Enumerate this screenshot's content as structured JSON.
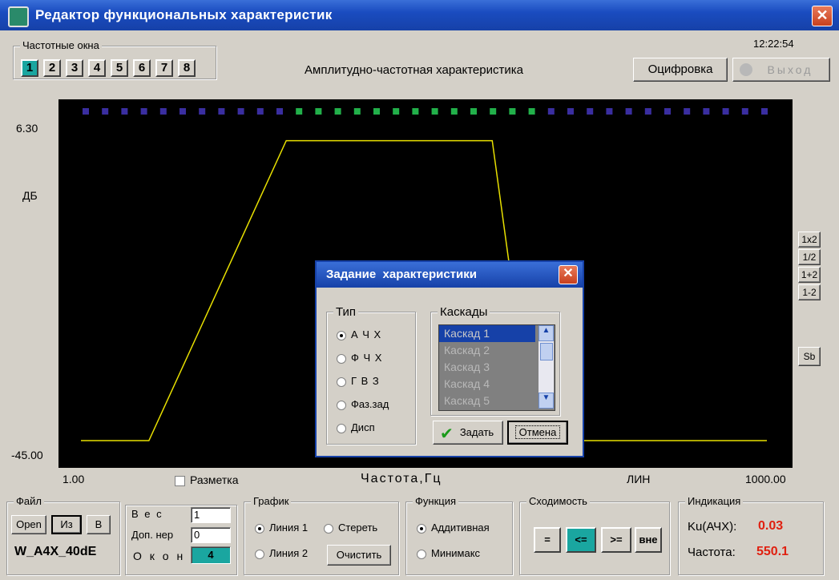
{
  "window": {
    "title": "Редактор функциональных характеристик"
  },
  "freq_windows": {
    "label": "Частотные окна",
    "buttons": [
      "1",
      "2",
      "3",
      "4",
      "5",
      "6",
      "7",
      "8"
    ],
    "selected": "1"
  },
  "clock": "12:22:54",
  "chart_title": "Амплитудно-частотная характеристика",
  "top_buttons": {
    "digitize": "Оцифровка",
    "exit": "Выход"
  },
  "plot": {
    "y_max_label": "6.30",
    "y_min_label": "-45.00",
    "y_unit": "ДБ",
    "x_min_label": "1.00",
    "x_max_label": "1000.00",
    "x_label": "Частота,Гц",
    "x_scale": "ЛИН",
    "grid_checkbox": "Разметка",
    "line_color": "#e8e000",
    "marker_colors": {
      "blue": "#3a2ea0",
      "green": "#22b04a"
    }
  },
  "chart_data": {
    "type": "line",
    "x": [
      1,
      100,
      300,
      600,
      660,
      1000
    ],
    "y": [
      -45,
      -45,
      4,
      4,
      -45,
      -45
    ],
    "xlim": [
      1,
      1000
    ],
    "ylim": [
      -45,
      6.3
    ],
    "markers_total": 36,
    "markers_green": [
      11,
      23
    ]
  },
  "side_buttons": [
    "1x2",
    "1/2",
    "1+2",
    "1-2",
    "Sb"
  ],
  "dialog": {
    "title": "Задание  характеристики",
    "type_label": "Тип",
    "types": [
      "А Ч Х",
      "Ф Ч Х",
      "Г В З",
      "Фаз.зад",
      "Дисп"
    ],
    "type_selected": 0,
    "cascades_label": "Каскады",
    "cascades": [
      "Каскад 1",
      "Каскад 2",
      "Каскад 3",
      "Каскад 4",
      "Каскад 5"
    ],
    "ok": "Задать",
    "cancel": "Отмена"
  },
  "file": {
    "label": "Файл",
    "open": "Open",
    "from": "Из",
    "to": "В",
    "filename": "W_A4X_40dE"
  },
  "params": {
    "weight_label": "В е с",
    "weight": "1",
    "extra_label": "Доп. нер",
    "extra": "0",
    "windows_label": "О к о н",
    "windows": "4"
  },
  "graph": {
    "label": "График",
    "line1": "Линия 1",
    "erase": "Стереть",
    "line2": "Линия 2",
    "clear": "Очистить"
  },
  "function": {
    "label": "Функция",
    "additive": "Аддитивная",
    "minimax": "Минимакс"
  },
  "convergence": {
    "label": "Сходимость",
    "buttons": [
      "=",
      "<=",
      ">=",
      "вне"
    ],
    "selected": "<="
  },
  "indication": {
    "label": "Индикация",
    "ku_label": "Ku(АЧХ):",
    "ku_value": "0.03",
    "freq_label": "Частота:",
    "freq_value": "550.1"
  }
}
